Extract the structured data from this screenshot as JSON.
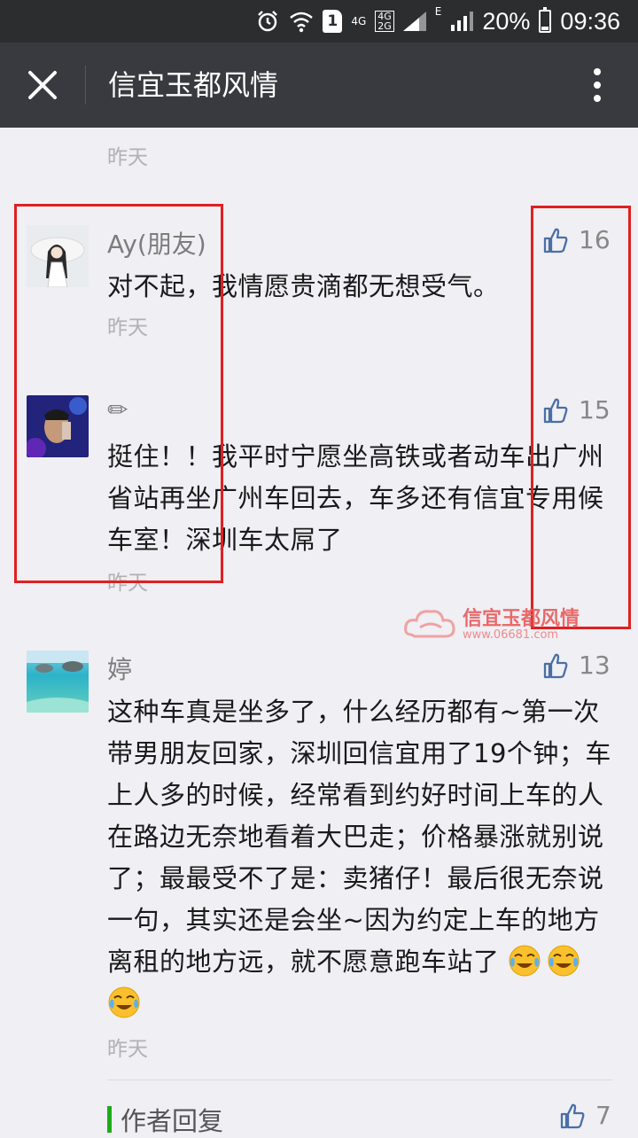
{
  "status_bar": {
    "sim_slot": "1",
    "net_4g": "4G",
    "net_4g_top": "4G",
    "net_2g_bottom": "2G",
    "net_e": "E",
    "battery": "20%",
    "time": "09:36"
  },
  "header": {
    "title": "信宜玉都风情"
  },
  "top_time": "昨天",
  "comments": [
    {
      "nickname": "Ay(朋友)",
      "text": "对不起，我情愿贵滴都无想受气。",
      "time": "昨天",
      "likes": "16"
    },
    {
      "nickname": "✏",
      "text": "挺住！！我平时宁愿坐高铁或者动车出广州省站再坐广州车回去，车多还有信宜专用候车室！深圳车太屌了",
      "time": "昨天",
      "likes": "15"
    },
    {
      "nickname": "婷",
      "text": "这种车真是坐多了，什么经历都有~第一次带男朋友回家，深圳回信宜用了19个钟；车上人多的时候，经常看到约好时间上车的人在路边无奈地看着大巴走；价格暴涨就别说了；最最受不了是：卖猪仔！最后很无奈说一句，其实还是会坐~因为约定上车的地方离租的地方远，就不愿意跑车站了",
      "time": "昨天",
      "likes": "13"
    }
  ],
  "author_reply": {
    "label": "作者回复",
    "likes": "7"
  },
  "watermark": {
    "title": "信宜玉都风情",
    "url": "www.06681.com"
  },
  "colors": {
    "status_bar": "#2b2d2f",
    "title_bar": "#393a3f",
    "background": "#efeff4",
    "highlight_box": "#e02020",
    "reply_accent": "#1aad19",
    "like_icon": "#4a6fa5"
  }
}
